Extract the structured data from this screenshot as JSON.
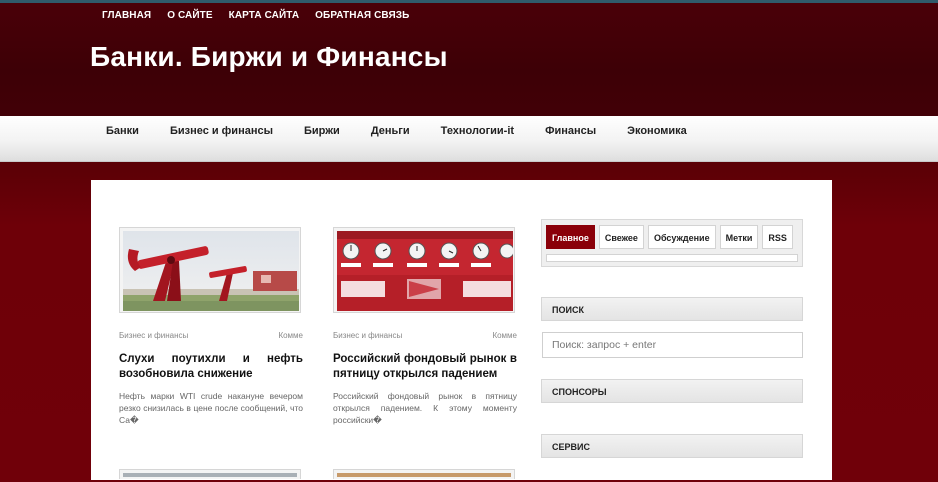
{
  "top_nav": [
    "ГЛАВНАЯ",
    "О САЙТЕ",
    "КАРТА САЙТА",
    "ОБРАТНАЯ СВЯЗЬ"
  ],
  "site_title": "Банки. Биржи и Финансы",
  "categories": [
    "Банки",
    "Бизнес и финансы",
    "Биржи",
    "Деньги",
    "Технологии-it",
    "Финансы",
    "Экономика"
  ],
  "posts": [
    {
      "category": "Бизнес и финансы",
      "comments": "Комме",
      "title": "Слухи поутихли и нефть возобновила снижение",
      "excerpt": "Нефть марки WTI crude накануне вечером резко снизилась в цене после сообщений, что Са�",
      "image": "oil-pump-photo"
    },
    {
      "category": "Бизнес и финансы",
      "comments": "Комме",
      "title": "Российский фондовый рынок в пятницу открылся падением",
      "excerpt": "Российский фондовый рынок в пятницу открылся падением. К этому моменту российски�",
      "image": "stock-exchange-clocks-photo"
    }
  ],
  "sidebar": {
    "tabs": [
      "Главное",
      "Свежее",
      "Обсуждение",
      "Метки",
      "RSS"
    ],
    "active_tab": "Главное",
    "search_title": "ПОИСК",
    "search_placeholder": "Поиск: запрос + enter",
    "sponsors_title": "СПОНСОРЫ",
    "service_title": "СЕРВИС"
  },
  "colors": {
    "header_bg": "#420007",
    "page_bg": "#6e0008",
    "accent": "#8a0009"
  }
}
